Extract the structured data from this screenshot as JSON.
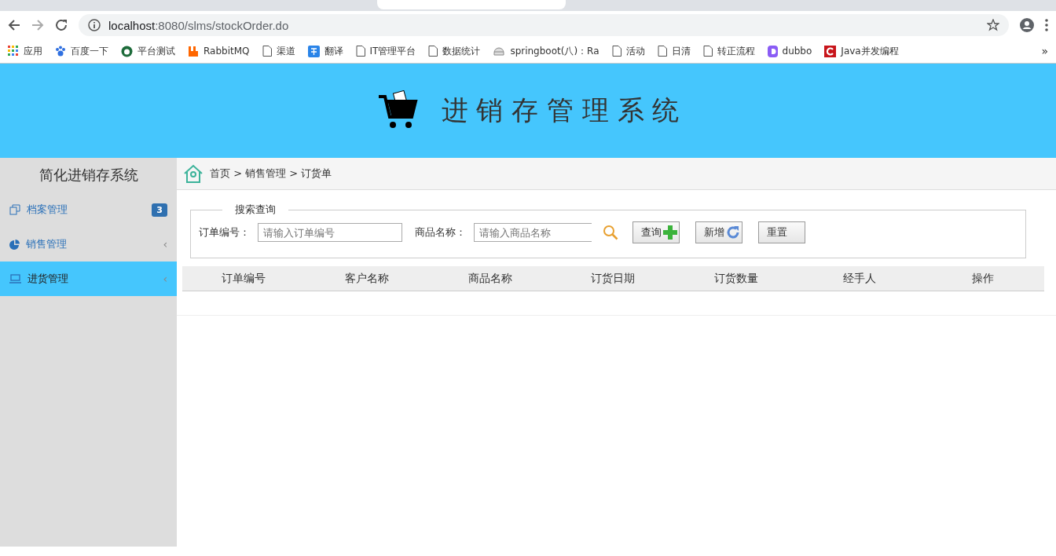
{
  "browser": {
    "url_host": "localhost",
    "url_rest": ":8080/slms/stockOrder.do",
    "bookmarks": [
      {
        "kind": "apps",
        "label": "应用"
      },
      {
        "kind": "paw",
        "label": "百度一下"
      },
      {
        "kind": "round",
        "label": "平台测试"
      },
      {
        "kind": "rabbit",
        "label": "RabbitMQ"
      },
      {
        "kind": "page",
        "label": "渠道"
      },
      {
        "kind": "translate",
        "label": "翻译"
      },
      {
        "kind": "page",
        "label": "IT管理平台"
      },
      {
        "kind": "page",
        "label": "数据统计"
      },
      {
        "kind": "helmet",
        "label": "springboot(八)：Ra"
      },
      {
        "kind": "page",
        "label": "活动"
      },
      {
        "kind": "page",
        "label": "日清"
      },
      {
        "kind": "page",
        "label": "转正流程"
      },
      {
        "kind": "dubbo",
        "label": "dubbo"
      },
      {
        "kind": "java",
        "label": "Java并发编程"
      }
    ],
    "overflow": "»"
  },
  "header": {
    "title": "进 销 存 管 理 系 统"
  },
  "sidebar": {
    "title": "简化进销存系统",
    "items": [
      {
        "kind": "copy",
        "label": "档案管理",
        "badge": "3",
        "selected": false
      },
      {
        "kind": "pie",
        "label": "销售管理",
        "arrow": "‹",
        "selected": false
      },
      {
        "kind": "laptop",
        "label": "进货管理",
        "arrow": "‹",
        "selected": true
      }
    ]
  },
  "breadcrumb": "首页 > 销售管理 > 订货单",
  "search": {
    "legend": "搜索查询",
    "fields": [
      {
        "label": "订单编号：",
        "placeholder": "请输入订单编号",
        "kind": "plain"
      },
      {
        "label": "商品名称：",
        "placeholder": "请输入商品名称",
        "kind": "search"
      }
    ],
    "buttons": [
      {
        "label": "查询",
        "kind": "plus"
      },
      {
        "label": "新增",
        "kind": "refresh"
      },
      {
        "label": "重置",
        "kind": "none"
      }
    ]
  },
  "table": {
    "columns": [
      "订单编号",
      "客户名称",
      "商品名称",
      "订货日期",
      "订货数量",
      "经手人",
      "操作"
    ]
  }
}
